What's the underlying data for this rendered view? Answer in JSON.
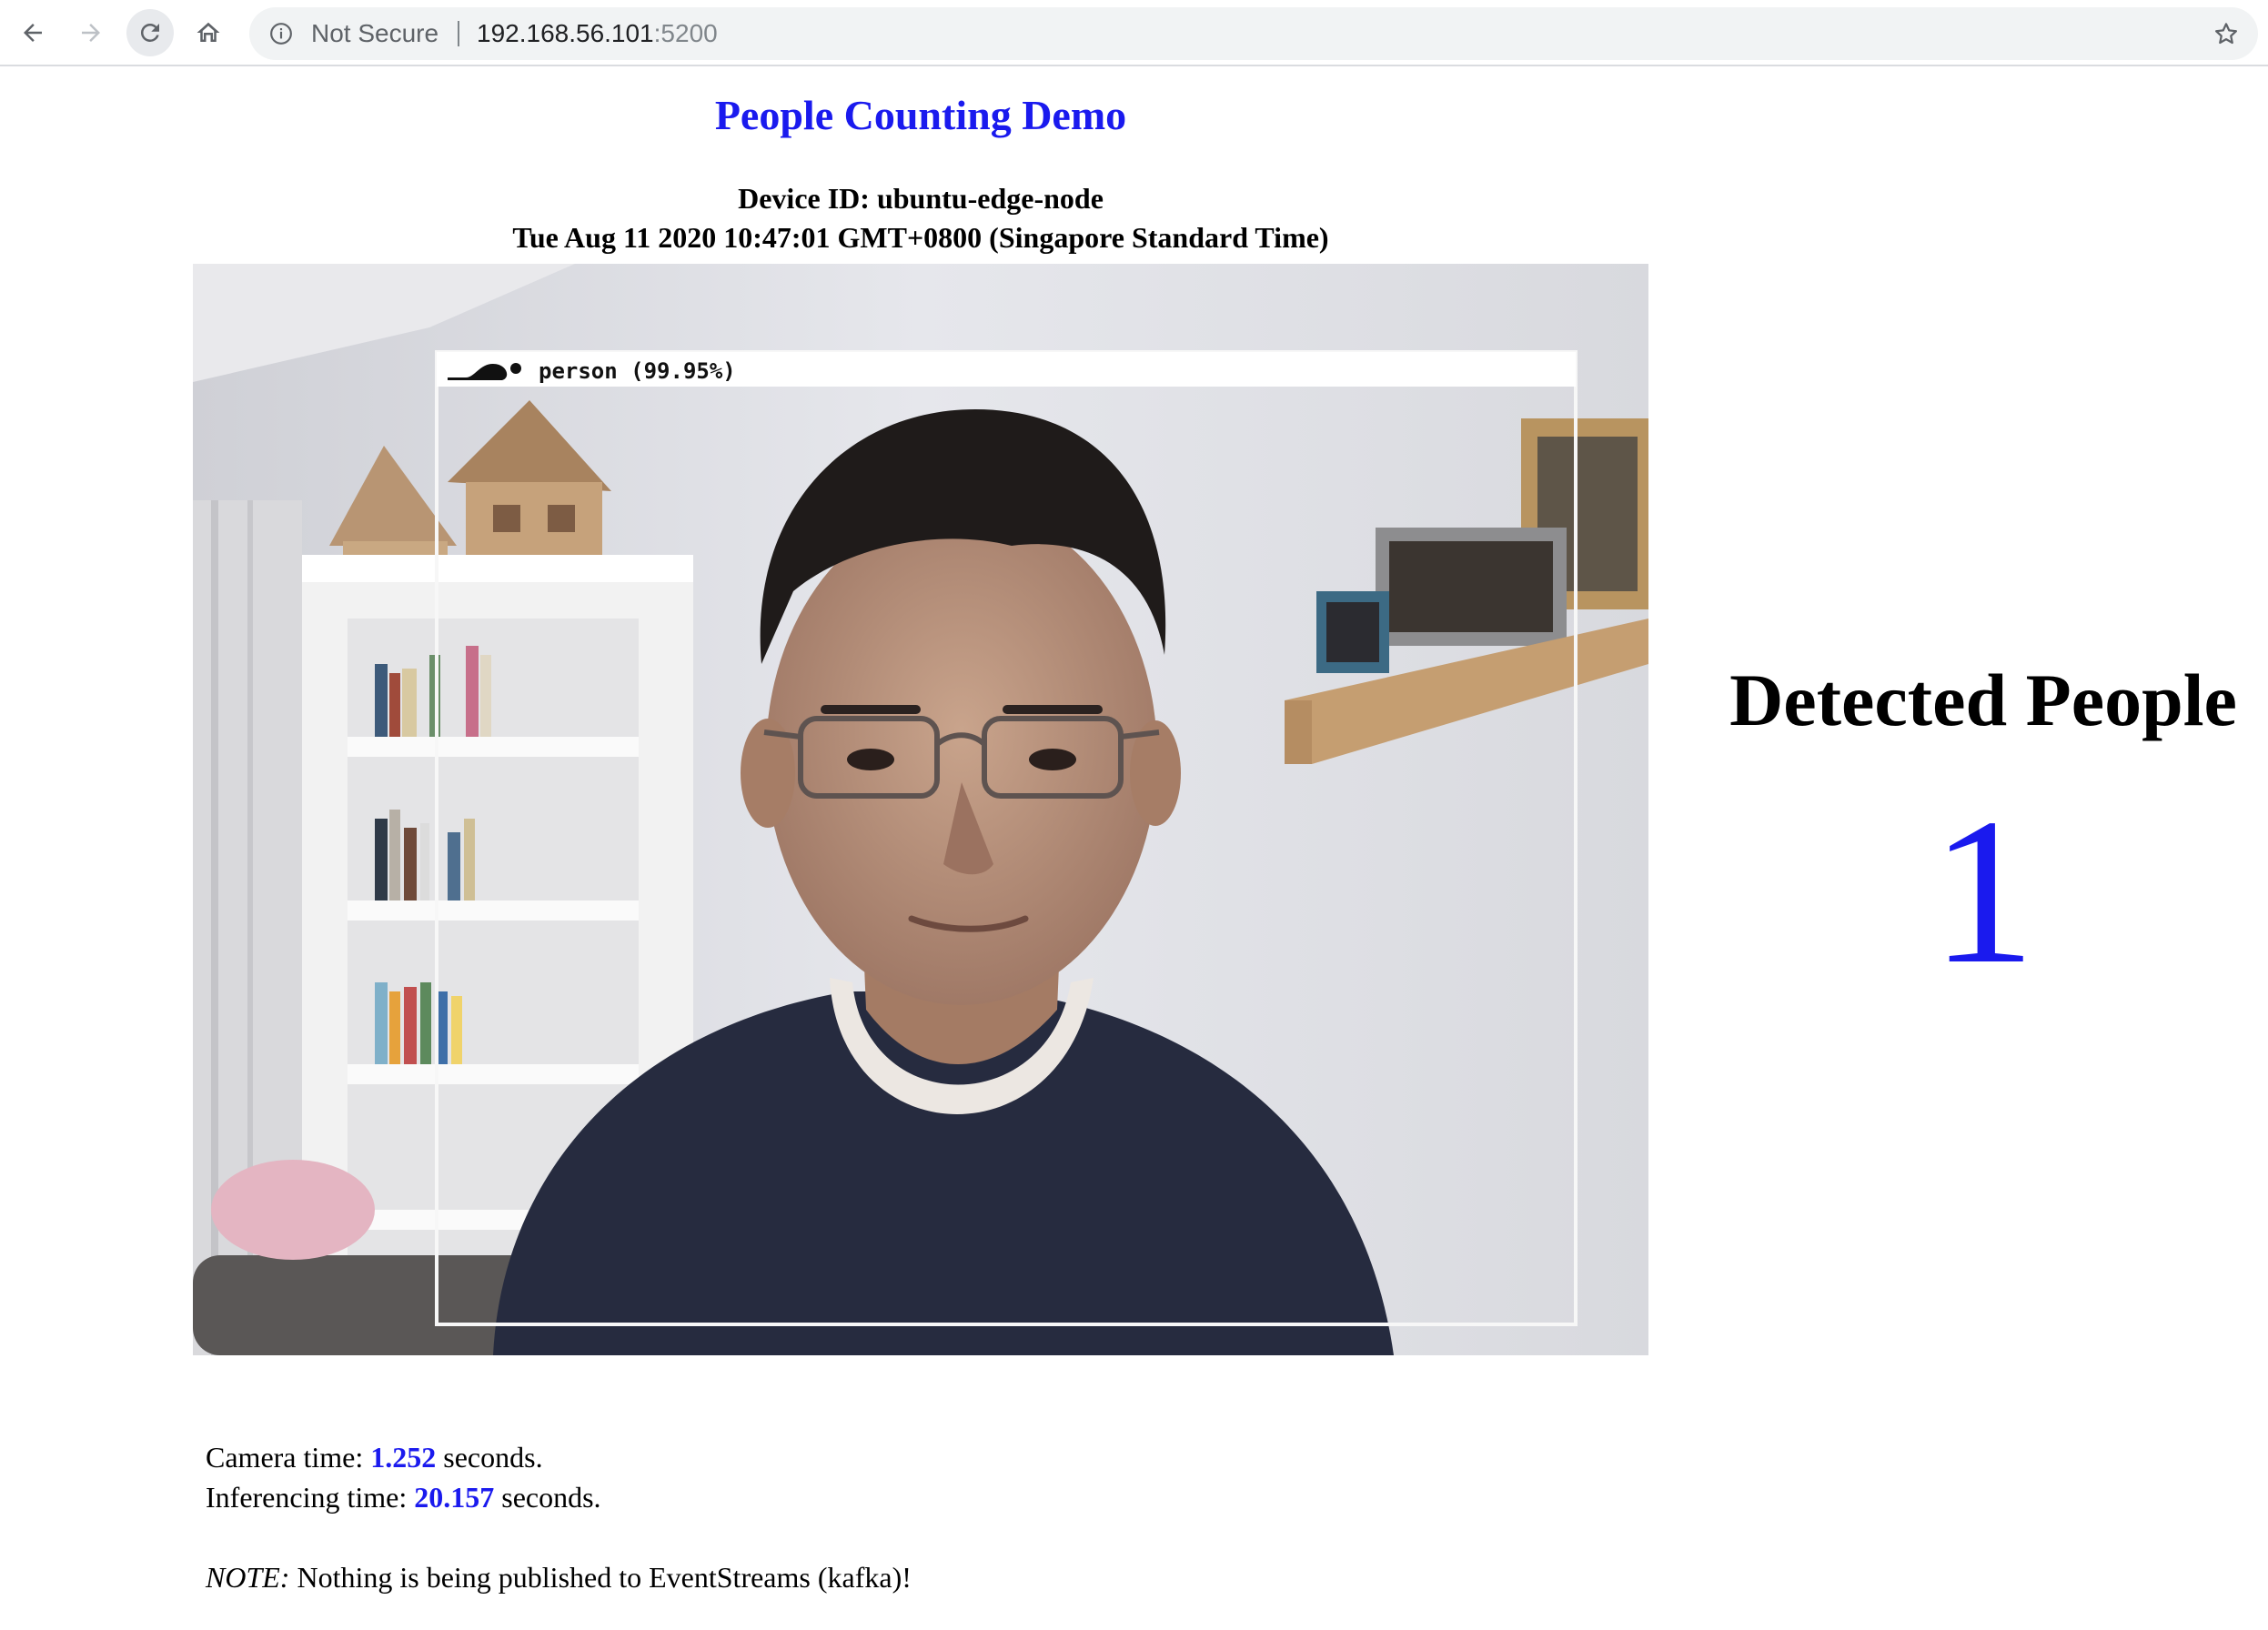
{
  "browser": {
    "security_label": "Not Secure",
    "url_host": "192.168.56.101",
    "url_port": ":5200"
  },
  "page": {
    "title": "People Counting Demo",
    "device_prefix": "Device ID: ",
    "device_id": "ubuntu-edge-node",
    "timestamp": "Tue Aug 11 2020 10:47:01 GMT+0800 (Singapore Standard Time)"
  },
  "detection": {
    "box_label": "person (99.95%)",
    "class": "person",
    "confidence_percent": 99.95
  },
  "summary": {
    "label": "Detected People",
    "count": "1"
  },
  "stats": {
    "camera_label": "Camera time: ",
    "camera_value": "1.252",
    "camera_unit": " seconds.",
    "inference_label": "Inferencing time: ",
    "inference_value": "20.157",
    "inference_unit": " seconds."
  },
  "note": {
    "label": "NOTE:",
    "text": " Nothing is being published to EventStreams (kafka)!"
  },
  "colors": {
    "accent_blue": "#1a1aee",
    "chrome_gray": "#5f6368"
  }
}
